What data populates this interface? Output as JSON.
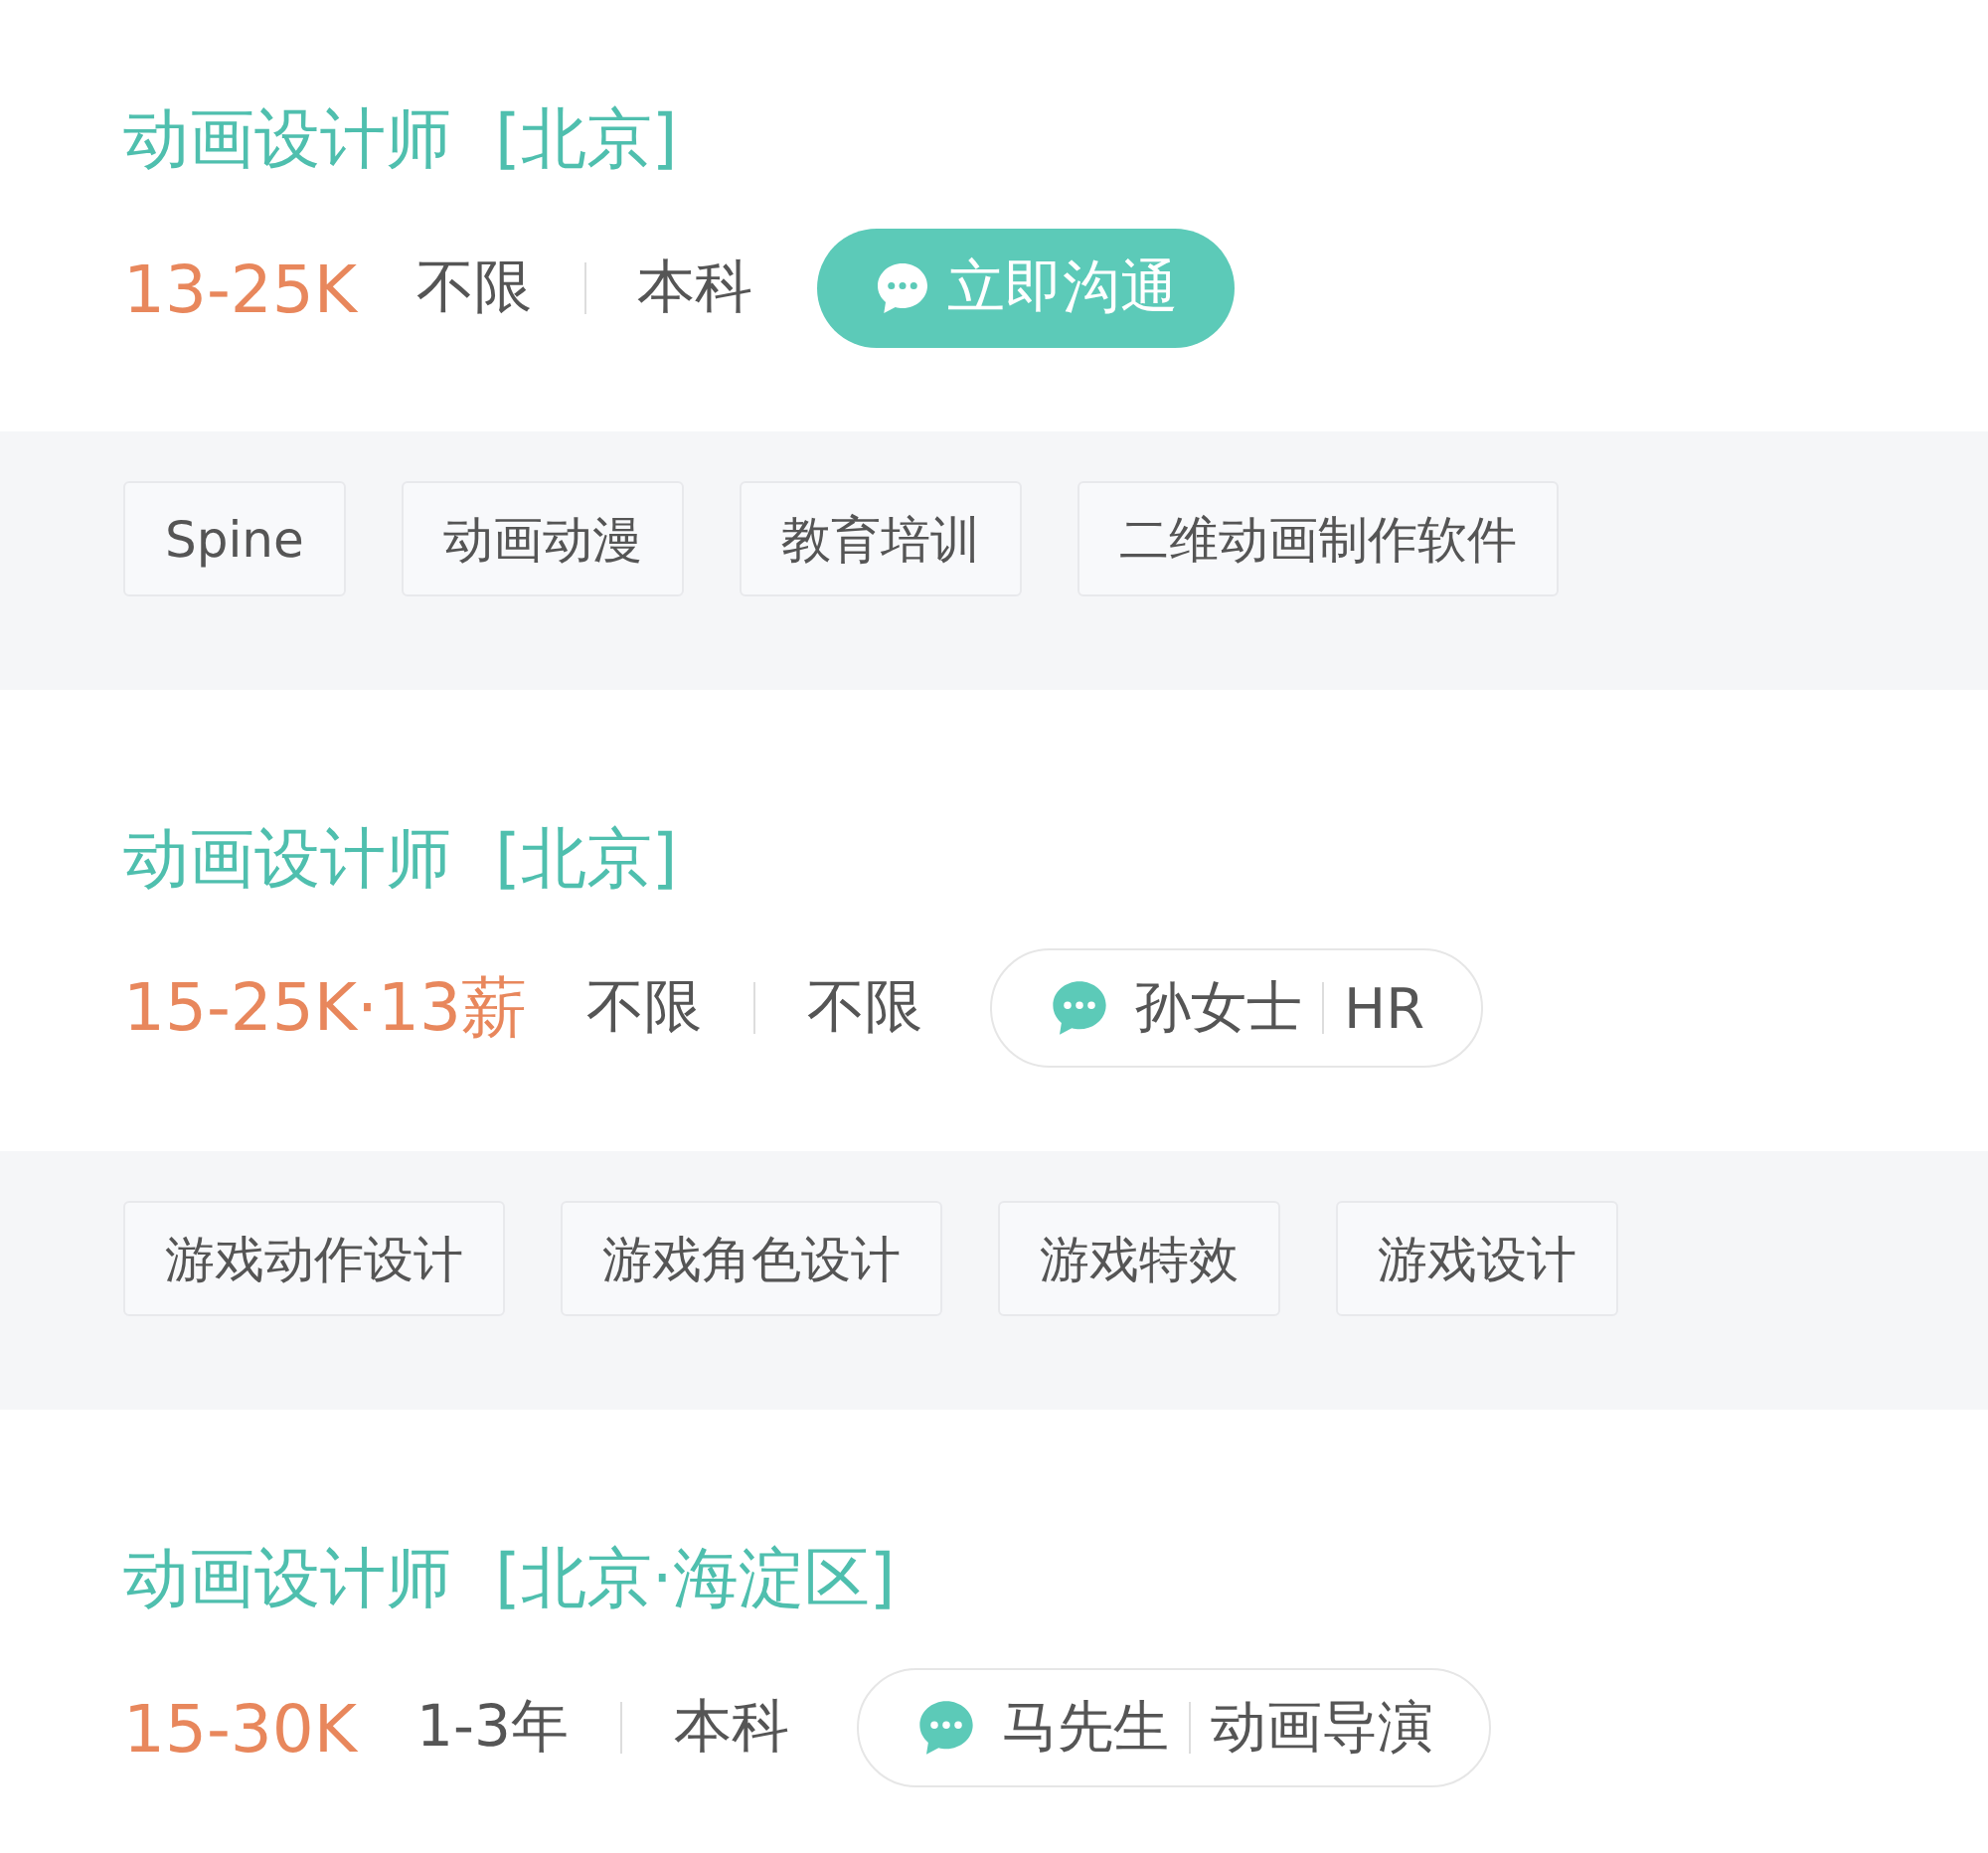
{
  "jobs": [
    {
      "title": "动画设计师",
      "location": "[北京]",
      "salary": "13-25K",
      "requirements": [
        "不限",
        "本科"
      ],
      "action": {
        "kind": "chat_button",
        "label": "立即沟通"
      },
      "tags": [
        "Spine",
        "动画动漫",
        "教育培训",
        "二维动画制作软件"
      ]
    },
    {
      "title": "动画设计师",
      "location": "[北京]",
      "salary": "15-25K·13薪",
      "requirements": [
        "不限",
        "不限"
      ],
      "action": {
        "kind": "contact",
        "name": "孙女士",
        "role": "HR"
      },
      "tags": [
        "游戏动作设计",
        "游戏角色设计",
        "游戏特效",
        "游戏设计"
      ]
    },
    {
      "title": "动画设计师",
      "location": "[北京·海淀区]",
      "salary": "15-30K",
      "requirements": [
        "1-3年",
        "本科"
      ],
      "action": {
        "kind": "contact",
        "name": "马先生",
        "role": "动画导演"
      }
    }
  ]
}
